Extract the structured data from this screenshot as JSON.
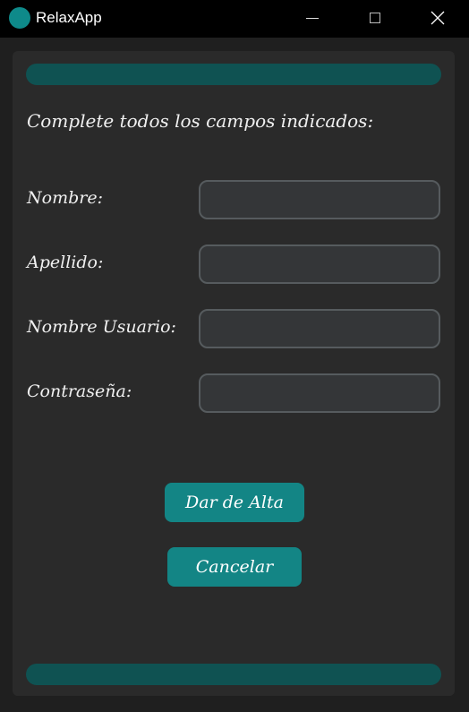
{
  "window": {
    "title": "RelaxApp",
    "controls": [
      "minimize-icon",
      "maximize-icon",
      "close-icon"
    ]
  },
  "form": {
    "instructions": "Complete todos los campos indicados:",
    "fields": [
      {
        "label": "Nombre:",
        "value": "",
        "placeholder": ""
      },
      {
        "label": "Apellido:",
        "value": "",
        "placeholder": ""
      },
      {
        "label": "Nombre Usuario:",
        "value": "",
        "placeholder": ""
      },
      {
        "label": "Contraseña:",
        "value": "",
        "placeholder": ""
      }
    ],
    "submit_label": "Dar de Alta",
    "cancel_label": "Cancelar"
  },
  "colors": {
    "accent": "#138585",
    "progress_bar": "#0f5252",
    "panel": "#2a2a2a",
    "input_bg": "#343638",
    "input_border": "#565b5e",
    "titlebar": "#000000"
  }
}
